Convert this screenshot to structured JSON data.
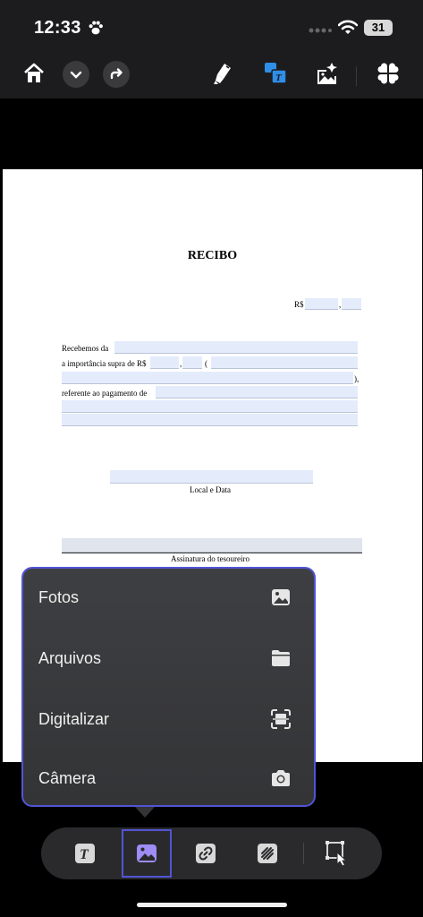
{
  "status_bar": {
    "time": "12:33",
    "battery": "31"
  },
  "toolbar": {
    "home_icon": "house-icon",
    "dropdown_icon": "chevron-down-icon",
    "redo_icon": "redo-icon",
    "highlighter_icon": "highlighter-icon",
    "translate_icon": "text-box-icon",
    "image_edit_icon": "image-edit-icon",
    "grid_icon": "four-leaf-grid-icon"
  },
  "document": {
    "title": "RECIBO",
    "currency_label": "R$",
    "line1": "Recebemos da",
    "line2": "a importância supra de R$",
    "line2_paren": "(",
    "line3_end": "),",
    "line4": "referente ao pagamento de",
    "place_date": "Local e Data",
    "signature": "Assinatura do tesoureiro",
    "comma": ","
  },
  "popup": {
    "items": [
      {
        "label": "Fotos",
        "icon": "photo-icon"
      },
      {
        "label": "Arquivos",
        "icon": "folder-icon"
      },
      {
        "label": "Digitalizar",
        "icon": "scan-icon"
      },
      {
        "label": "Câmera",
        "icon": "camera-icon"
      }
    ]
  },
  "bottom_bar": {
    "text_tool": "text-tool-icon",
    "image_tool": "image-tool-icon",
    "link_tool": "link-icon",
    "signature_tool": "signature-icon",
    "select_tool": "select-area-icon"
  },
  "colors": {
    "accent": "#5254d6",
    "field": "#e4ecfb",
    "toolbar_blue": "#2f8ee8"
  }
}
